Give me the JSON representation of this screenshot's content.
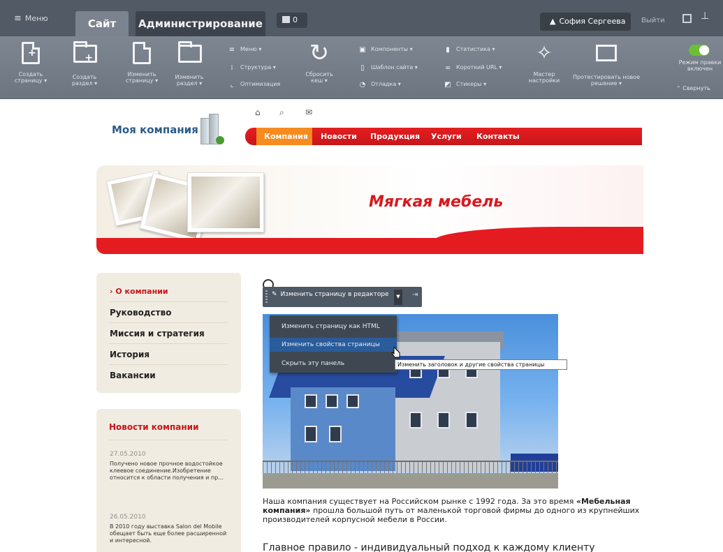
{
  "admin": {
    "menu_label": "Меню",
    "tabs": [
      "Сайт",
      "Администрирование"
    ],
    "counter": "0",
    "user": "София Сергеева",
    "logout": "Выйти"
  },
  "toolbar": {
    "create_page": "Создать страницу ▾",
    "create_section": "Создать раздел ▾",
    "edit_page": "Изменить страницу ▾",
    "edit_section": "Изменить раздел ▾",
    "menu": "Меню ▾",
    "structure": "Структура ▾",
    "optimization": "Оптимизация",
    "reset_cache": "Сбросить кеш ▾",
    "components": "Компоненты ▾",
    "site_template": "Шаблон сайта ▾",
    "debug": "Отладка ▾",
    "statistics": "Статистика ▾",
    "short_url": "Короткий URL ▾",
    "stickers": "Стикеры ▾",
    "wizard": "Мастер настройки",
    "test_solution": "Протестировать новое решение ▾",
    "edit_mode": "Режим правки включен",
    "collapse": "Свернуть"
  },
  "site": {
    "logo": "Моя компания",
    "nav": [
      "Компания",
      "Новости",
      "Продукция",
      "Услуги",
      "Контакты"
    ],
    "banner_title": "Мягкая мебель"
  },
  "left_menu": [
    "О компании",
    "Руководство",
    "Миссия и стратегия",
    "История",
    "Вакансии"
  ],
  "news": {
    "title": "Новости компании",
    "items": [
      {
        "date": "27.05.2010",
        "text": "Получено новое прочное водостойкое клеевое соединение.Изобретение относится к области получения и пр..."
      },
      {
        "date": "26.05.2010",
        "text": "В 2010 году выставка Salon del Mobile обещает быть еще более расширенной и интересной."
      }
    ]
  },
  "content": {
    "para_start": "Наша компания существует на Российском рынке с 1992 года. За это время ",
    "para_bold": "«Мебельная компания»",
    "para_end": " прошла большой путь от маленькой торговой фирмы до одного из крупнейших производителей корпусной мебели в России.",
    "heading": "Главное правило - индивидуальный подход к каждому клиенту"
  },
  "edit_panel": {
    "button": "Изменить страницу в редакторе",
    "dropdown": [
      "Изменить страницу как HTML",
      "Изменить свойства страницы",
      "Скрыть эту панель"
    ],
    "tooltip": "Изменить заголовок и другие свойства страницы"
  },
  "colors": {
    "admin_dark": "#525a65",
    "toolbar": "#7e8692",
    "brand_red": "#e41b20",
    "nav_active": "#f68b1f",
    "menu_bg": "#f1ece1"
  }
}
